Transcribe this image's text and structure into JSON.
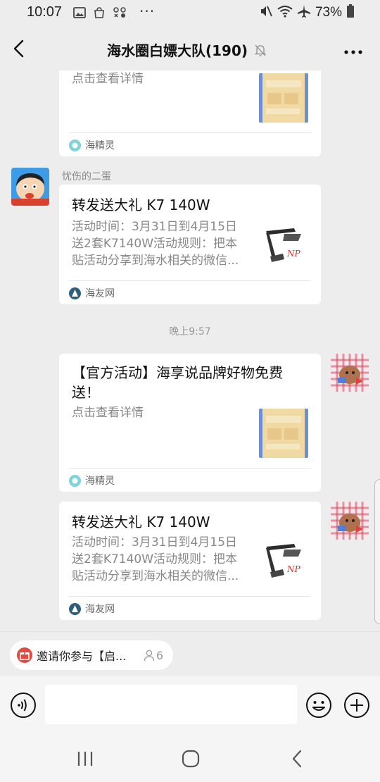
{
  "status_bar": {
    "time": "10:07",
    "more": "···",
    "battery_pct": "73%"
  },
  "title_bar": {
    "title": "海水圈白嫖大队(190)"
  },
  "messages": [
    {
      "kind": "card",
      "title": "",
      "desc": "点击查看详情",
      "source": "海精灵"
    },
    {
      "kind": "card",
      "sender": "忧伤的二蛋",
      "title": "转发送大礼 K7 140W",
      "desc_lines": [
        "活动时间：3月31日到4月15日",
        "送2套K7140W活动规则：把本",
        "贴活动分享到海水相关的微信..."
      ],
      "source": "海友网"
    },
    {
      "kind": "time",
      "text": "晚上9:57"
    },
    {
      "kind": "card",
      "title_lines": [
        "【官方活动】海享说品牌好物免费",
        "送！"
      ],
      "desc": "点击查看详情",
      "source": "海精灵"
    },
    {
      "kind": "card",
      "title": "转发送大礼 K7 140W",
      "desc_lines": [
        "活动时间：3月31日到4月15日",
        "送2套K7140W活动规则：把本",
        "贴活动分享到海水相关的微信..."
      ],
      "source": "海友网"
    }
  ],
  "pinned": {
    "text": "邀请你参与【启...",
    "count": "6"
  },
  "input": {
    "placeholder": ""
  },
  "colors": {
    "background": "#ededed",
    "card": "#ffffff",
    "pinned_icon": "#e14a3f"
  }
}
